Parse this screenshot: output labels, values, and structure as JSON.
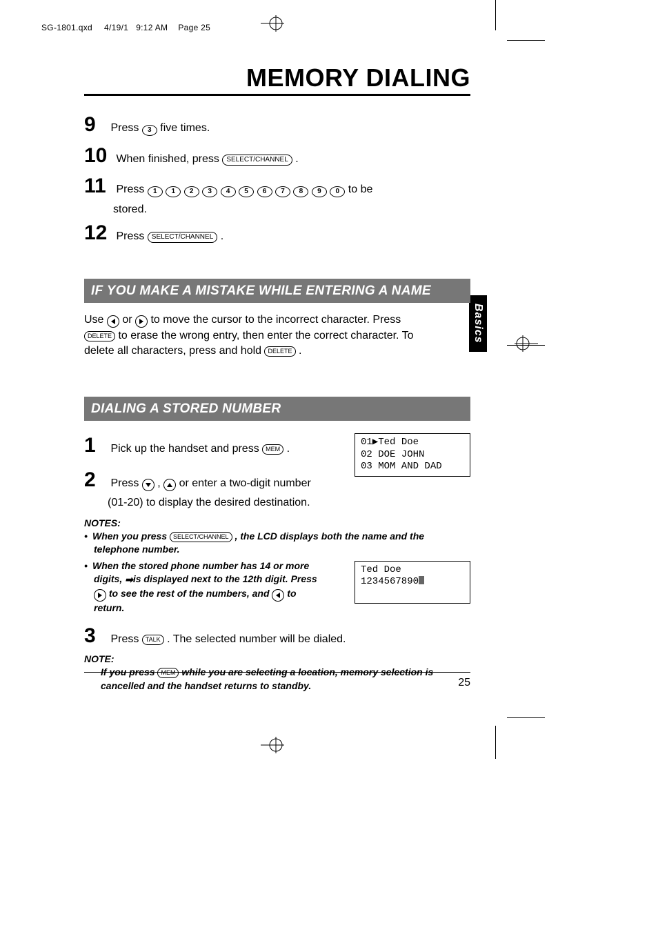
{
  "meta": {
    "filename": "SG-1801.qxd",
    "date": "4/19/1",
    "time": "9:12 AM",
    "page_label": "Page 25"
  },
  "title": "MEMORY DIALING",
  "steps_top": {
    "s9": {
      "num": "9",
      "a": "Press ",
      "b": " five times."
    },
    "s10": {
      "num": "10",
      "a": "When finished, press ",
      "b": " ."
    },
    "s11": {
      "num": "11",
      "a": "Press ",
      "b": " to be",
      "sub": "stored."
    },
    "s12": {
      "num": "12",
      "a": "Press ",
      "b": " ."
    }
  },
  "keys": {
    "select_channel": "SELECT/CHANNEL",
    "delete": "DELETE",
    "mem": "MEM",
    "talk": "TALK",
    "digits": [
      "1",
      "1",
      "2",
      "3",
      "4",
      "5",
      "6",
      "7",
      "8",
      "9",
      "0"
    ],
    "three": "3"
  },
  "sections": {
    "mistake": {
      "heading": "IF YOU MAKE A MISTAKE WHILE ENTERING A NAME",
      "p1a": "Use ",
      "p1b": " or ",
      "p1c": " to move the cursor to the incorrect character. Press",
      "p2a": " to erase the wrong entry, then enter the correct character. To",
      "p3a": "delete all characters, press and hold ",
      "p3b": "."
    },
    "dialing": {
      "heading": "DIALING A STORED NUMBER",
      "s1": {
        "num": "1",
        "a": "Pick up the handset and press ",
        "b": " ."
      },
      "s2": {
        "num": "2",
        "a": "Press ",
        "mid": " , ",
        "b": " or enter a two-digit number",
        "sub": "(01-20) to display the desired destination."
      },
      "notes_head": "NOTES:",
      "note1_a": "When you press ",
      "note1_b": " , the LCD displays both the name and the",
      "note1_c": "telephone number.",
      "note2_a": "When the stored phone number has 14 or more",
      "note2_b": "digits, ",
      "note2_arrow": "➡",
      "note2_c": "is displayed next to the 12th digit.  Press",
      "note2_d": " to see the rest of the numbers, and ",
      "note2_e": " to",
      "note2_f": "return.",
      "s3": {
        "num": "3",
        "a": "Press ",
        "b": " .  The selected number will be dialed."
      },
      "note_head": "NOTE:",
      "note3_a": "If you press ",
      "note3_b": " while you are selecting a location, memory selection is",
      "note3_c": "cancelled and the handset returns to standby."
    }
  },
  "lcd1": {
    "l1": "01▶Ted Doe",
    "l2": "02 DOE JOHN",
    "l3": "03 MOM AND DAD"
  },
  "lcd2": {
    "l1": "Ted Doe",
    "l2": "1234567890"
  },
  "side_tab": "Basics",
  "page_number": "25"
}
